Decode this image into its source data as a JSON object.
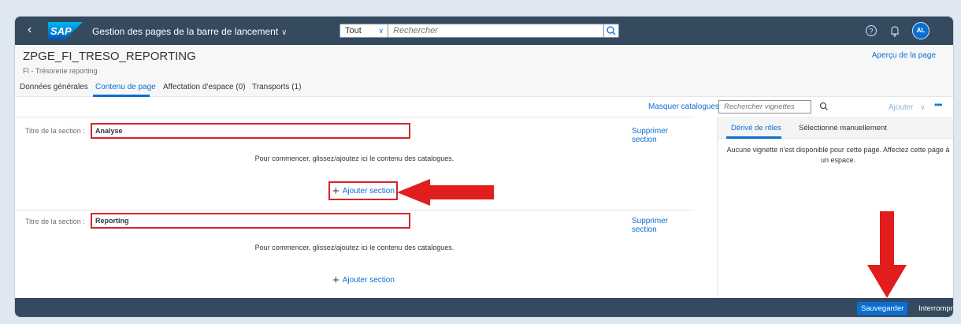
{
  "shell": {
    "back_icon": "‹",
    "logo_text": "SAP",
    "title": "Gestion des pages de la barre de lancement",
    "scope_value": "Tout",
    "search_placeholder": "Rechercher",
    "avatar_initials": "AL"
  },
  "header": {
    "title": "ZPGE_FI_TRESO_REPORTING",
    "subtitle": "FI - Trésorerie reporting",
    "preview_link": "Aperçu de la page",
    "tabs": [
      {
        "label": "Données générales"
      },
      {
        "label": "Contenu de page",
        "active": true
      },
      {
        "label": "Affectation d'espace (0)"
      },
      {
        "label": "Transports (1)"
      }
    ]
  },
  "toolbar": {
    "hide_catalogs": "Masquer catalogues",
    "tile_search_placeholder": "Rechercher vignettes",
    "add_label": "Ajouter",
    "more_icon": "•••"
  },
  "sections": [
    {
      "label": "Titre de la section :",
      "value": "Analyse",
      "delete_label": "Supprimer section",
      "hint": "Pour commencer, glissez/ajoutez ici le contenu des catalogues.",
      "add_label": "Ajouter section"
    },
    {
      "label": "Titre de la section :",
      "value": "Reporting",
      "delete_label": "Supprimer section",
      "hint": "Pour commencer, glissez/ajoutez ici le contenu des catalogues.",
      "add_label": "Ajouter section"
    }
  ],
  "right_pane": {
    "tabs": [
      {
        "label": "Dérivé de rôles",
        "active": true
      },
      {
        "label": "Sélectionné manuellement"
      }
    ],
    "message": "Aucune vignette n'est disponible pour cette page. Affectez cette page à un espace."
  },
  "footer": {
    "save_label": "Sauvegarder",
    "cancel_label": "Interrompre"
  },
  "colors": {
    "shell": "#354a5f",
    "accent": "#0a6ed1",
    "annotation_red": "#e11d1d"
  }
}
